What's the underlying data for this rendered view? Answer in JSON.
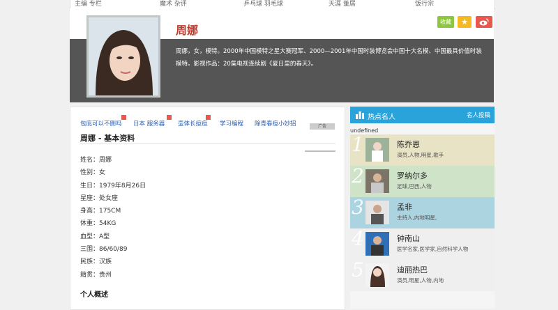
{
  "topnav": [
    "主编 专栏",
    "魔术 杂评",
    "乒乓球 羽毛球",
    "天涯 董居",
    "饭行宗"
  ],
  "hero": {
    "name": "周娜",
    "desc": "周娜，女，模特。2000年中国模特之星大赛冠军、2000—2001年中国时装博览会中国十大名模、中国最具价值时装模特。影视作品：20集电视连续剧《夏日里的春天》。",
    "fav": "收藏",
    "star": "★",
    "weibo": "微博"
  },
  "links": [
    "包庇可以不删吗",
    "日本 服务器",
    "壶体长痘痘",
    "学习编程",
    "除青春痘小妙招"
  ],
  "ad": "广告",
  "section_title": "周娜 - 基本资料",
  "info": [
    "姓名：周娜",
    "性别：女",
    "生日：1979年8月26日",
    "星座：处女座",
    "身高：175CM",
    "体重：54KG",
    "血型：A型",
    "三围：86/60/89",
    "民族：汉族",
    "籍贯：贵州"
  ],
  "overview_title": "个人概述",
  "sidebar": {
    "title": "热点名人",
    "submit": "名人投稿",
    "undefined_text": "undefined",
    "people": [
      {
        "rank": "1",
        "name": "陈乔恩",
        "tags": "演员,人物,明星,歌手",
        "bg": "#e9e3c6"
      },
      {
        "rank": "2",
        "name": "罗纳尔多",
        "tags": "足球,巴西,人物",
        "bg": "#cfe3c9"
      },
      {
        "rank": "3",
        "name": "孟非",
        "tags": "主持人,内地明星,",
        "bg": "#acd4e0"
      },
      {
        "rank": "4",
        "name": "钟南山",
        "tags": "医学名家,医学家,自然科学人物",
        "bg": "#efefef"
      },
      {
        "rank": "5",
        "name": "迪丽热巴",
        "tags": "演员,明星,人物,内地",
        "bg": "#efefef"
      }
    ]
  }
}
